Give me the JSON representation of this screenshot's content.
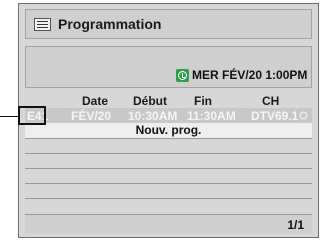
{
  "header": {
    "title": "Programmation",
    "icon": "list-icon"
  },
  "info": {
    "clock_icon": "clock-icon",
    "datetime": "MER FÉV/20 1:00PM"
  },
  "table": {
    "columns": [
      "Date",
      "Début",
      "Fin",
      "CH"
    ],
    "entry": {
      "number": "E41",
      "date": "FÉV/20",
      "start": "10:30AM",
      "end": "11:30AM",
      "channel": "DTV69.1",
      "media_icon": "disc-icon"
    },
    "new_program_label": "Nouv. prog."
  },
  "footer": {
    "page": "1/1"
  },
  "colors": {
    "panel": "#d7d7d7",
    "clock_icon": "#2e9e48"
  }
}
